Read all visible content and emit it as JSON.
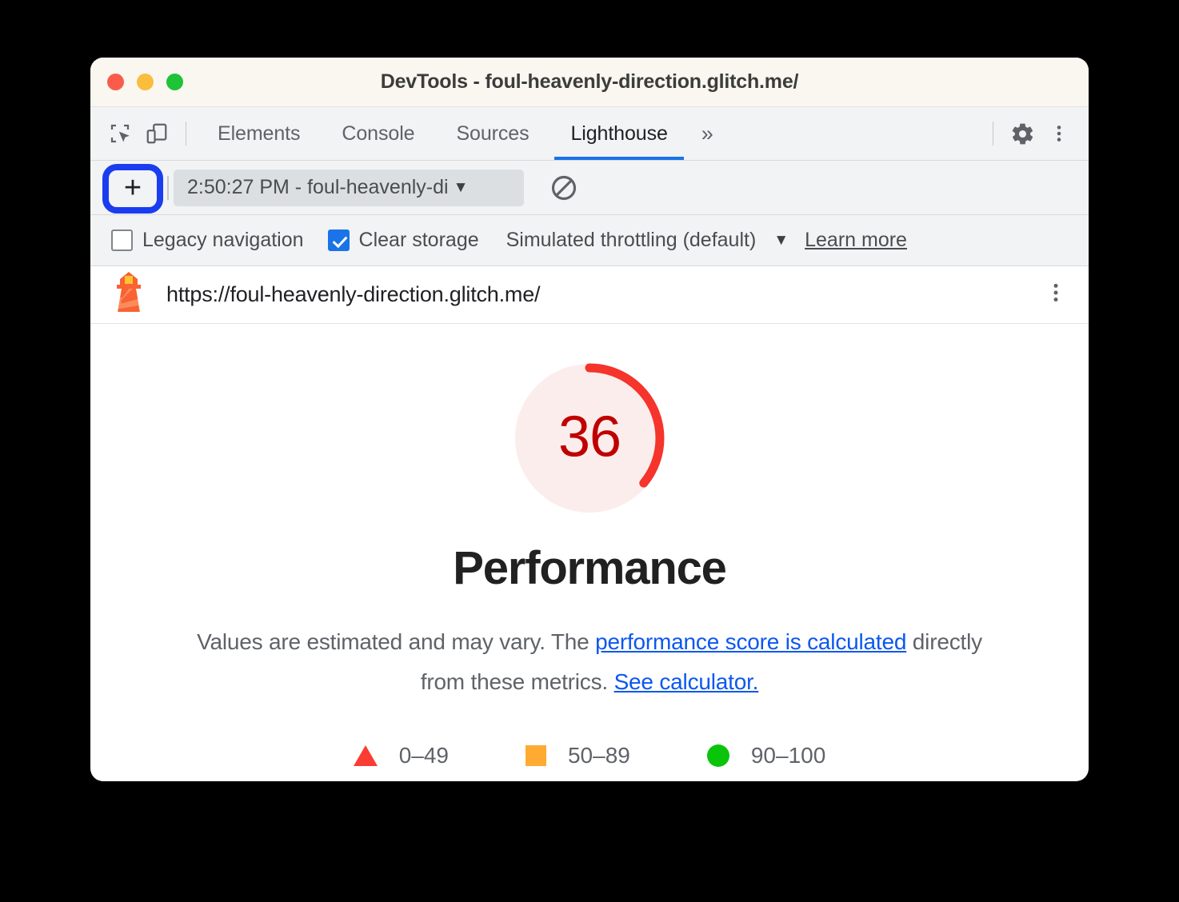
{
  "window": {
    "title": "DevTools - foul-heavenly-direction.glitch.me/",
    "traffic_lights": [
      "close",
      "minimize",
      "maximize"
    ]
  },
  "devtools_tabbar": {
    "inspect_icon": "inspect-element-icon",
    "device_toggle_icon": "device-toolbar-icon",
    "tabs": [
      {
        "label": "Elements",
        "active": false
      },
      {
        "label": "Console",
        "active": false
      },
      {
        "label": "Sources",
        "active": false
      },
      {
        "label": "Lighthouse",
        "active": true
      }
    ],
    "overflow_label": "»",
    "settings_icon": "gear-icon",
    "more_icon": "more-vertical-icon"
  },
  "lighthouse_toolbar": {
    "add_label": "+",
    "report_select_value": "2:50:27 PM - foul-heavenly-di",
    "caret": "▼",
    "clear_icon": "block-circle-icon"
  },
  "options": {
    "legacy_navigation": {
      "label": "Legacy navigation",
      "checked": false
    },
    "clear_storage": {
      "label": "Clear storage",
      "checked": true
    },
    "throttling": {
      "label": "Simulated throttling (default)",
      "caret": "▼"
    },
    "learn_more": "Learn more"
  },
  "report_header": {
    "lighthouse_icon": "lighthouse-icon",
    "url": "https://foul-heavenly-direction.glitch.me/",
    "menu_icon": "more-vertical-icon"
  },
  "report": {
    "title": "Performance",
    "description_part1": "Values are estimated and may vary. The ",
    "link1": "performance score is calculated",
    "description_part2": " directly from these metrics. ",
    "link2": "See calculator."
  },
  "legend": [
    {
      "shape": "triangle",
      "label": "0–49",
      "color": "#fa3c34"
    },
    {
      "shape": "square",
      "label": "50–89",
      "color": "#ffaa33"
    },
    {
      "shape": "circle",
      "label": "90–100",
      "color": "#0ac40a"
    }
  ],
  "chart_data": {
    "type": "gauge",
    "title": "Performance",
    "value": 36,
    "value_label": "36",
    "min": 0,
    "max": 100,
    "ranges": [
      {
        "label": "0–49",
        "from": 0,
        "to": 49,
        "color": "#fa3c34",
        "shape": "triangle"
      },
      {
        "label": "50–89",
        "from": 50,
        "to": 89,
        "color": "#ffaa33",
        "shape": "square"
      },
      {
        "label": "90–100",
        "from": 90,
        "to": 100,
        "color": "#0ac40a",
        "shape": "circle"
      }
    ],
    "score_band": "0–49",
    "arc_color": "#f5342b",
    "track_color": "#fceded",
    "text_color": "#c00000"
  },
  "colors": {
    "accent_blue": "#1a73e8",
    "link_blue": "#0b57f0",
    "highlight_ring": "#1a3df0",
    "titlebar_bg": "#faf6f0",
    "toolbar_bg": "#f1f3f4"
  }
}
